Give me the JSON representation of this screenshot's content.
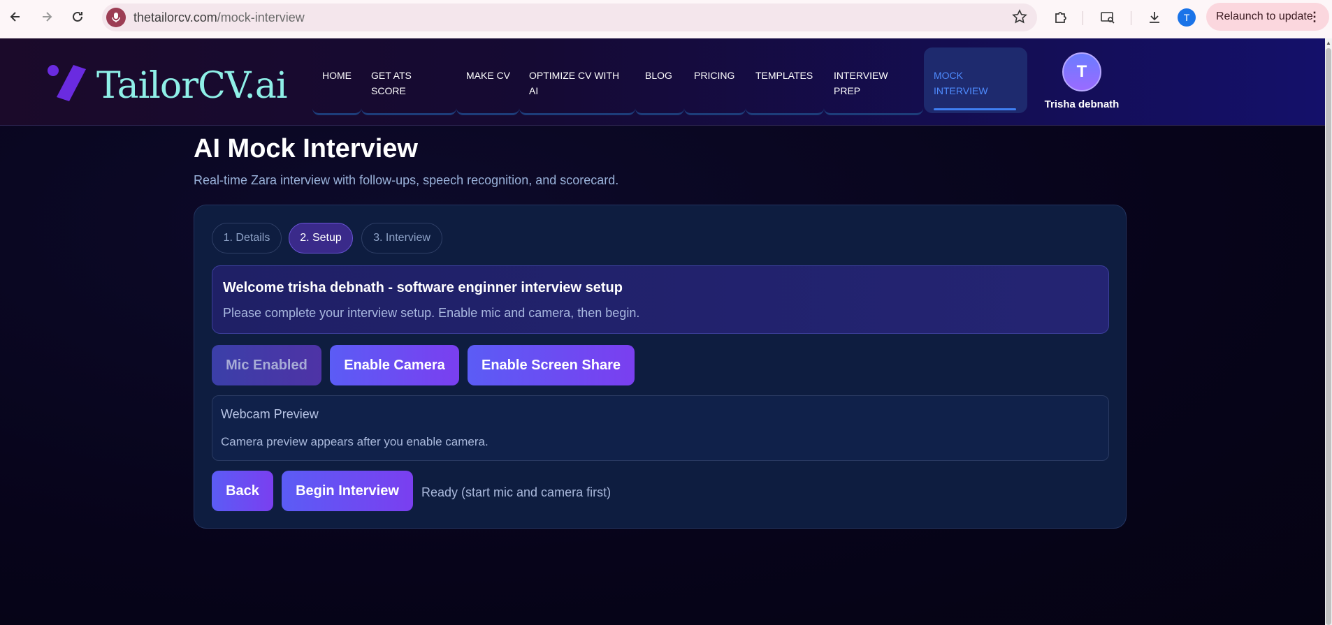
{
  "browser": {
    "url_domain": "thetailorcv.com",
    "url_path": "/mock-interview",
    "profile_initial": "T",
    "relaunch_label": "Relaunch to update"
  },
  "site": {
    "logo_text": "TailorCV.ai",
    "nav": [
      {
        "label": "HOME"
      },
      {
        "label": "GET ATS SCORE"
      },
      {
        "label": "MAKE CV"
      },
      {
        "label": "OPTIMIZE CV WITH AI"
      },
      {
        "label": "BLOG"
      },
      {
        "label": "PRICING"
      },
      {
        "label": "TEMPLATES"
      },
      {
        "label": "INTERVIEW PREP"
      },
      {
        "label": "MOCK INTERVIEW"
      }
    ],
    "user_initial": "T",
    "user_name": "Trisha debnath"
  },
  "page": {
    "title": "AI Mock Interview",
    "subtitle": "Real-time Zara interview with follow-ups, speech recognition, and scorecard.",
    "steps": [
      {
        "label": "1. Details"
      },
      {
        "label": "2. Setup"
      },
      {
        "label": "3. Interview"
      }
    ],
    "welcome_title": "Welcome trisha debnath - software enginner interview setup",
    "welcome_text": "Please complete your interview setup. Enable mic and camera, then begin.",
    "buttons": {
      "mic": "Mic Enabled",
      "camera": "Enable Camera",
      "screen": "Enable Screen Share",
      "back": "Back",
      "begin": "Begin Interview"
    },
    "preview_title": "Webcam Preview",
    "preview_text": "Camera preview appears after you enable camera.",
    "status": "Ready (start mic and camera first)"
  },
  "colors": {
    "accent_start": "#5b5cf5",
    "accent_end": "#7a3ff0",
    "logo_text": "#8ff0e8",
    "active_nav": "#4f8cff"
  }
}
